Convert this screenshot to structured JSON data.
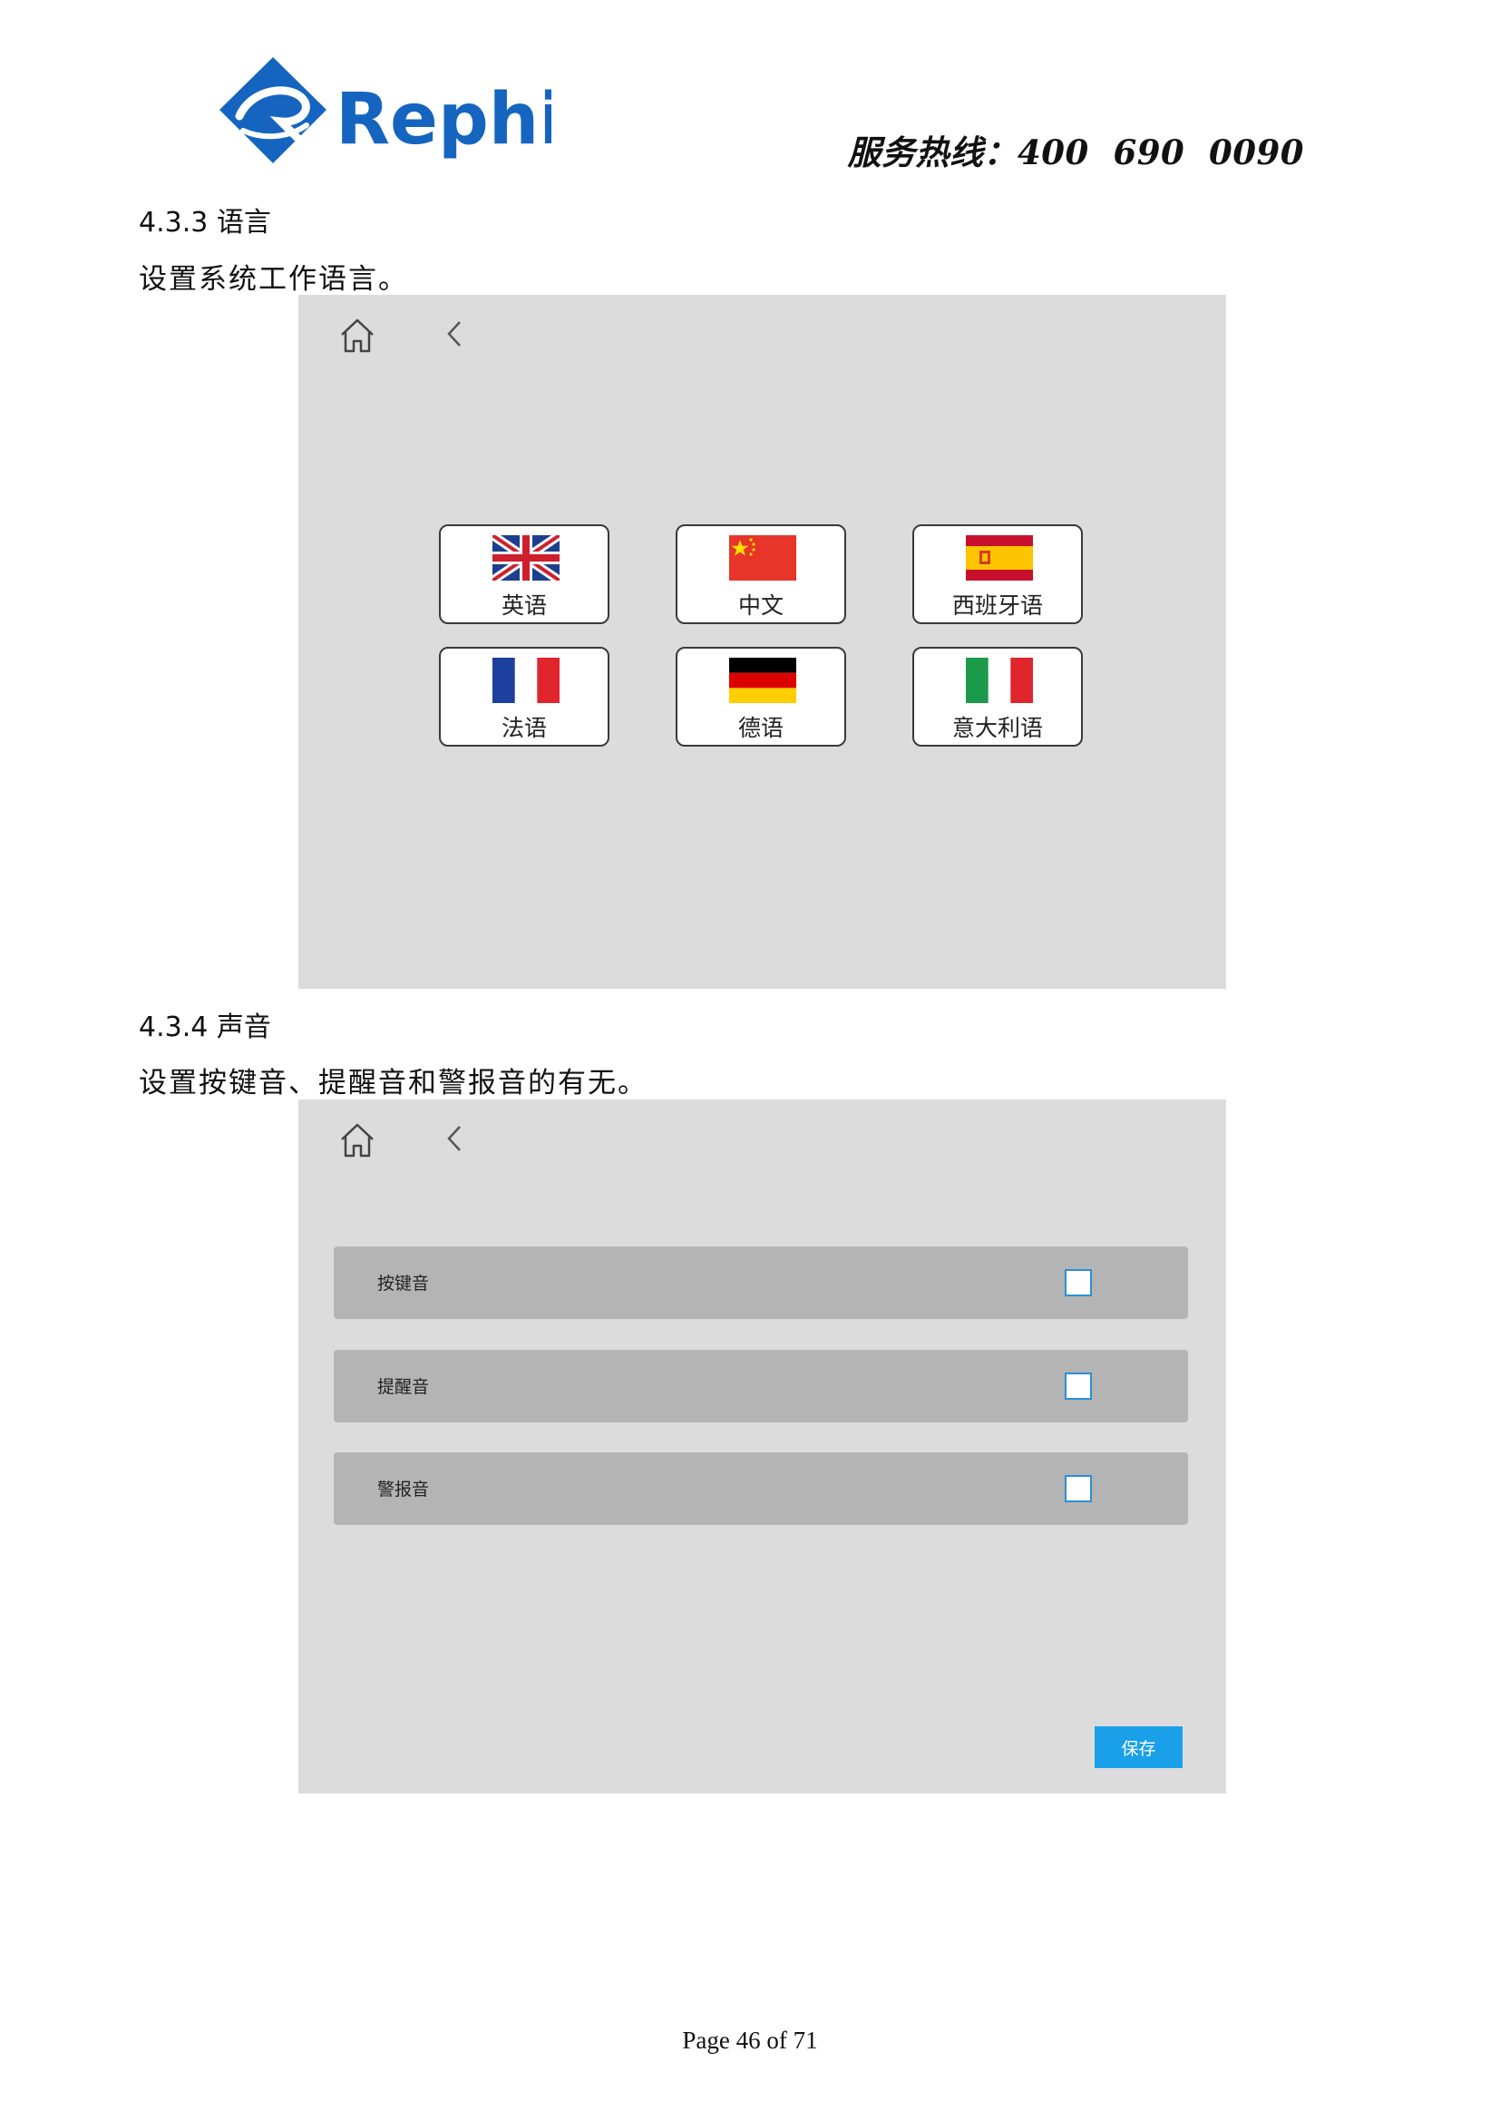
{
  "header": {
    "logo_text": "Rephile",
    "hotline": "服务热线：400  690  0090"
  },
  "section_language": {
    "heading": "4.3.3  语言",
    "description": "设置系统工作语言。",
    "buttons": [
      {
        "label": "英语",
        "flag": "uk-flag-icon"
      },
      {
        "label": "中文",
        "flag": "china-flag-icon"
      },
      {
        "label": "西班牙语",
        "flag": "spain-flag-icon"
      },
      {
        "label": "法语",
        "flag": "france-flag-icon"
      },
      {
        "label": "德语",
        "flag": "germany-flag-icon"
      },
      {
        "label": "意大利语",
        "flag": "italy-flag-icon"
      }
    ]
  },
  "section_sound": {
    "heading": "4.3.4  声音",
    "description": "设置按键音、提醒音和警报音的有无。",
    "rows": [
      {
        "label": "按键音",
        "checked": false
      },
      {
        "label": "提醒音",
        "checked": false
      },
      {
        "label": "警报音",
        "checked": false
      }
    ],
    "save_label": "保存"
  },
  "colors": {
    "brand_blue": "#1565c0",
    "screen_bg": "#dcdcdc",
    "row_bg": "#b4b4b4",
    "save_button": "#1aa0e8"
  },
  "footer": {
    "page": "Page 46 of 71"
  }
}
